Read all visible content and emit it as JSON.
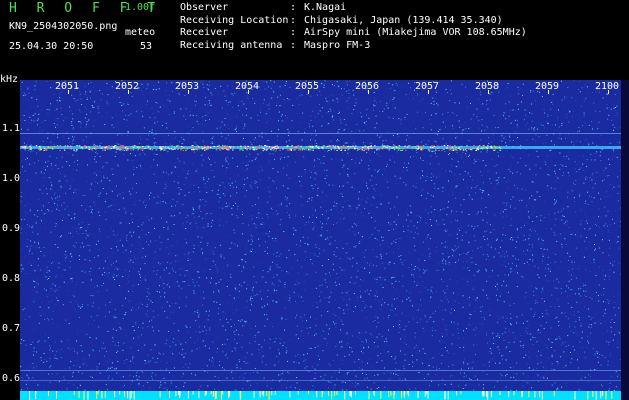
{
  "header": {
    "app_title": "H R O F F T",
    "app_version": "1.00f",
    "file_name": "KN9_2504302050.png",
    "meteo_label": "meteo",
    "datetime": "25.04.30 20:50",
    "meteo_count": "53"
  },
  "info": [
    {
      "key": "Observer",
      "value": "K.Nagai"
    },
    {
      "key": "Receiving Location",
      "value": "Chigasaki, Japan (139.414 35.340)"
    },
    {
      "key": "Receiver",
      "value": "AirSpy mini (Miakejima VOR 108.65MHz)"
    },
    {
      "key": "Receiving antenna",
      "value": "Maspro FM-3"
    }
  ],
  "plot": {
    "y_unit": "kHz",
    "time_ticks": [
      "2051",
      "2052",
      "2053",
      "2054",
      "2055",
      "2056",
      "2057",
      "2058",
      "2059",
      "2100"
    ],
    "freq_ticks": [
      "1.1",
      "1.0",
      "0.9",
      "0.8",
      "0.7",
      "0.6"
    ],
    "colors": {
      "background": "#1a2aa0",
      "noise": "#6fb8ff",
      "carrier": "#ff6060",
      "baseline": "#00e0ff"
    }
  }
}
